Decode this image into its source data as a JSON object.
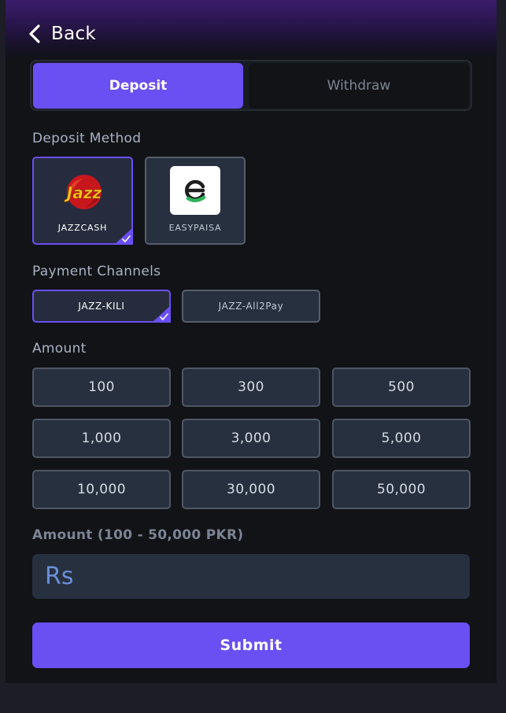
{
  "header": {
    "back_label": "Back"
  },
  "tabs": [
    {
      "label": "Deposit",
      "active": true
    },
    {
      "label": "Withdraw",
      "active": false
    }
  ],
  "deposit_method": {
    "label": "Deposit Method",
    "options": [
      {
        "label": "JAZZCASH",
        "selected": true,
        "logo_text": "Jazz"
      },
      {
        "label": "EASYPAISA",
        "selected": false
      }
    ]
  },
  "payment_channels": {
    "label": "Payment Channels",
    "options": [
      {
        "label": "JAZZ-KILI",
        "selected": true
      },
      {
        "label": "JAZZ-All2Pay",
        "selected": false
      }
    ]
  },
  "amount": {
    "label": "Amount",
    "presets": [
      "100",
      "300",
      "500",
      "1,000",
      "3,000",
      "5,000",
      "10,000",
      "30,000",
      "50,000"
    ],
    "range_label": "Amount (100 - 50,000 PKR)",
    "input_placeholder": "Rs",
    "input_value": ""
  },
  "submit_label": "Submit",
  "colors": {
    "accent": "#6a4ff2",
    "background": "#111316",
    "card": "#27303f",
    "easypaisa_green": "#2fb35a"
  }
}
